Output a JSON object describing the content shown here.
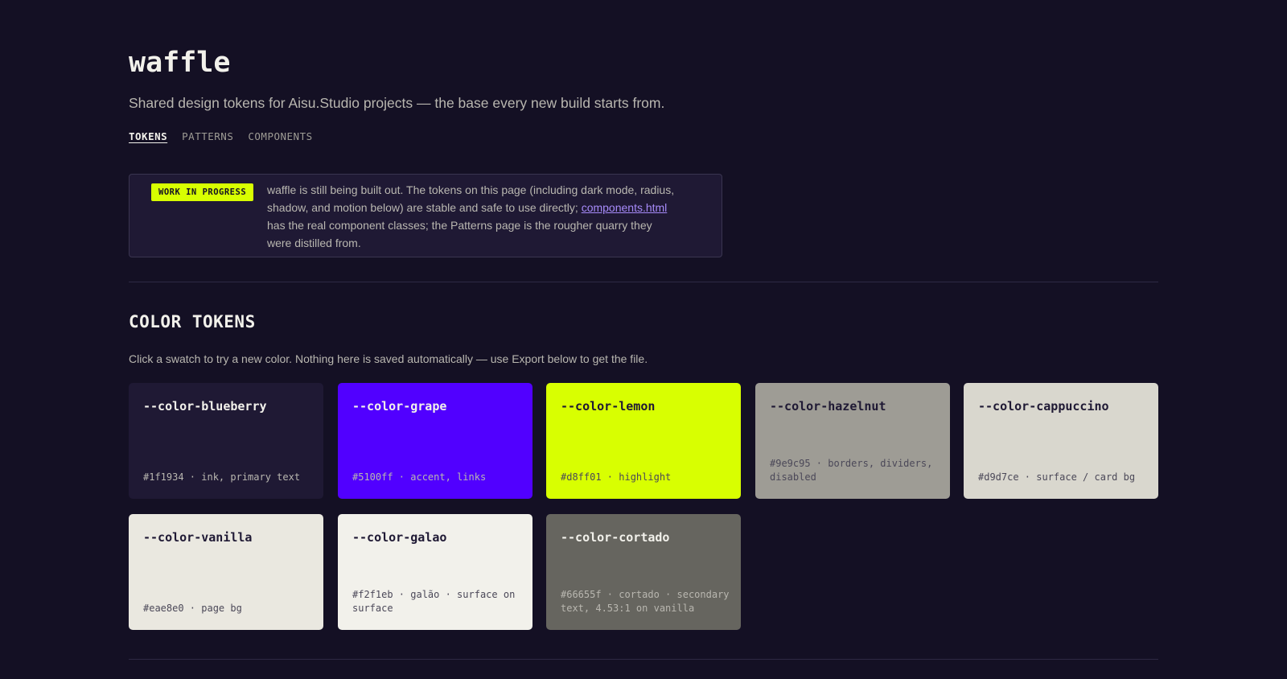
{
  "header": {
    "title": "waffle",
    "tagline": "Shared design tokens for Aisu.Studio projects — the base every new build starts from."
  },
  "nav": {
    "items": [
      "TOKENS",
      "PATTERNS",
      "COMPONENTS"
    ],
    "active": "TOKENS"
  },
  "notice": {
    "badge": "WORK IN PROGRESS",
    "text_before": "waffle is still being built out. The tokens on this page (including dark mode, radius, shadow, and motion below) are stable and safe to use directly; ",
    "link": "components.html",
    "text_after": " has the real component classes; the Patterns page is the rougher quarry they were distilled from."
  },
  "color_tokens": {
    "title": "COLOR TOKENS",
    "description": "Click a swatch to try a new color. Nothing here is saved automatically — use Export below to get the file.",
    "swatches": [
      {
        "name": "--color-blueberry",
        "meta": "#1f1934 · ink, primary text",
        "color": "#1f1934"
      },
      {
        "name": "--color-grape",
        "meta": "#5100ff · accent, links",
        "color": "#5100ff"
      },
      {
        "name": "--color-lemon",
        "meta": "#d8ff01 · highlight",
        "color": "#d8ff01"
      },
      {
        "name": "--color-hazelnut",
        "meta": "#9e9c95 · borders, dividers, disabled",
        "color": "#9e9c95"
      },
      {
        "name": "--color-cappuccino",
        "meta": "#d9d7ce · surface / card bg",
        "color": "#d9d7ce"
      },
      {
        "name": "--color-vanilla",
        "meta": "#eae8e0 · page bg",
        "color": "#eae8e0"
      },
      {
        "name": "--color-galao",
        "meta": "#f2f1eb · galão · surface on surface",
        "color": "#f2f1eb"
      },
      {
        "name": "--color-cortado",
        "meta": "#66655f · cortado · secondary text, 4.53:1 on vanilla",
        "color": "#66655f"
      }
    ]
  },
  "colors": {
    "page_bg": "#141024",
    "notice_bg": "#1f1934",
    "link": "#a78bfa"
  }
}
